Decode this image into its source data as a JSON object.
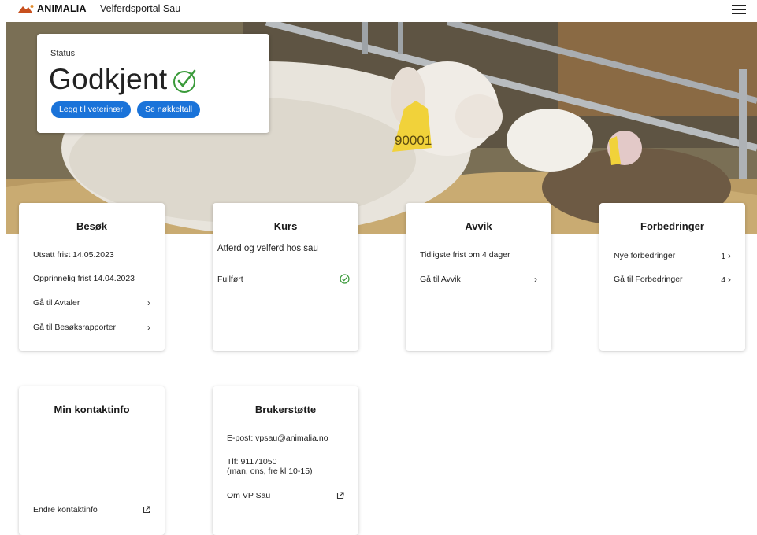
{
  "header": {
    "brand": "ANIMALIA",
    "portal_title": "Velferdsportal Sau",
    "menu_icon": "hamburger-menu-icon"
  },
  "colors": {
    "primary": "#1a73d9",
    "success": "#3a9a3a",
    "brand": "#c8501e"
  },
  "status": {
    "label": "Status",
    "value": "Godkjent",
    "icon": "check-icon",
    "add_vet_label": "Legg til veterinær",
    "key_figures_label": "Se nøkkeltall"
  },
  "cards": {
    "besok": {
      "title": "Besøk",
      "postponed": "Utsatt frist 14.05.2023",
      "original": "Opprinnelig frist 14.04.2023",
      "link_agreements": "Gå til Avtaler",
      "link_reports": "Gå til Besøksrapporter"
    },
    "kurs": {
      "title": "Kurs",
      "course": "Atferd og velferd hos sau",
      "status": "Fullført"
    },
    "avvik": {
      "title": "Avvik",
      "deadline": "Tidligste frist om 4 dager",
      "link": "Gå til Avvik"
    },
    "forbedringer": {
      "title": "Forbedringer",
      "new_label": "Nye forbedringer",
      "new_count": "1",
      "link": "Gå til Forbedringer",
      "link_count": "4"
    },
    "kontakt": {
      "title": "Min kontaktinfo",
      "edit": "Endre kontaktinfo"
    },
    "brukerstotte": {
      "title": "Brukerstøtte",
      "email": "E-post: vpsau@animalia.no",
      "phone": "Tlf: 91171050",
      "hours": "(man, ons, fre kl 10-15)",
      "about": "Om VP Sau"
    }
  },
  "hero": {
    "ear_tag_number": "90001"
  }
}
